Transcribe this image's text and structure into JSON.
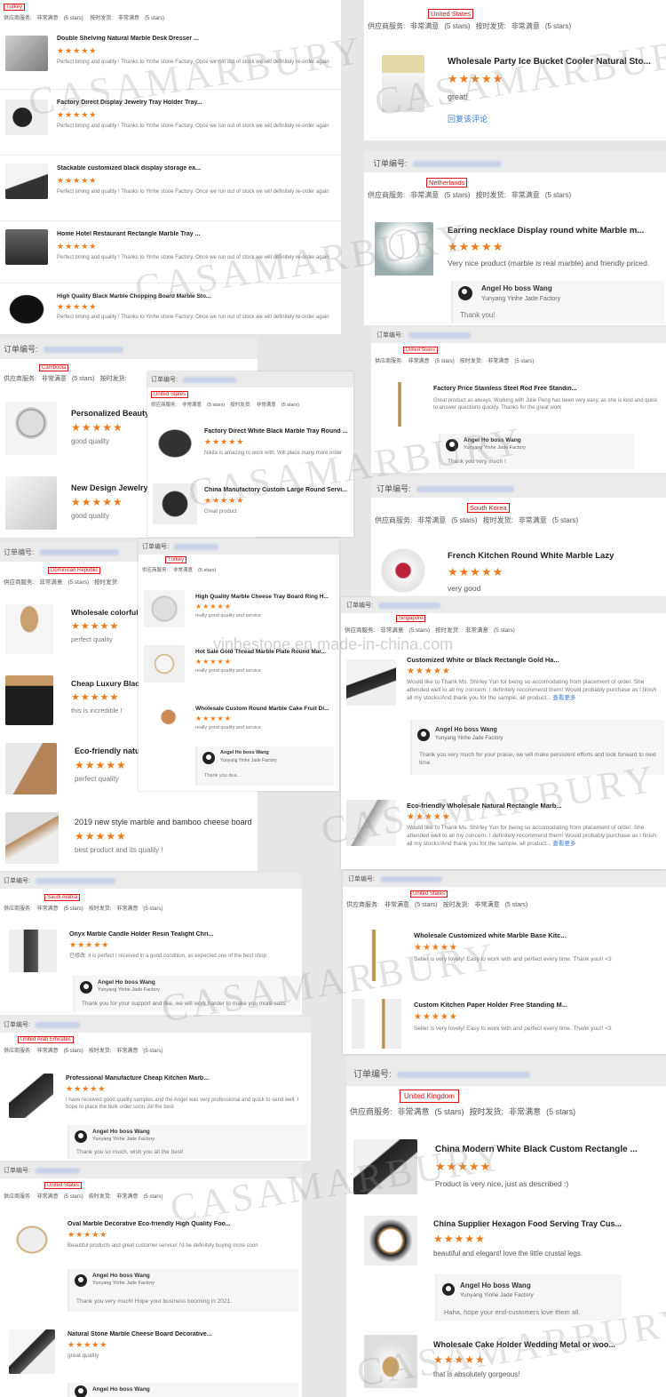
{
  "labels": {
    "order_no": "订单编号:",
    "supplier_service": "供应商服务:",
    "very_satisfied": "非常满意",
    "five_stars": "(5 stars)",
    "on_time": "按时发货:",
    "stars": "★★★★★",
    "reply_author": "Angel Ho boss Wang",
    "reply_factory": "Yunyang Yinhe Jade Factory"
  },
  "watermarks": [
    "CASAMARBURY",
    "yinhestone.en.made-in-china.com"
  ],
  "panels": {
    "a": {
      "country": "Turkey",
      "items": [
        {
          "title": "Double Shelving Natural Marble Desk Dresser ...",
          "review": "Perfect timing and quality ! Thanks to Yinhe stone Factory. Once we run out of stock we will definitely re-order again"
        },
        {
          "title": "Factory Direct Display Jewelry Tray Holder Tray...",
          "review": "Perfect timing and quality ! Thanks to Yinhe stone Factory. Once we run out of stock we will definitely re-order again"
        },
        {
          "title": "Stackable customized black display storage ea...",
          "review": "Perfect timing and quality ! Thanks to Yinhe stone Factory. Once we run out of stock we will definitely re-order again"
        },
        {
          "title": "Home Hotel Restaurant Rectangle Marble Tray ...",
          "review": "Perfect timing and quality ! Thanks to Yinhe stone Factory. Once we run out of stock we will definitely re-order again"
        },
        {
          "title": "High Quality Black Marble Chopping Board Marble Sto...",
          "review": "Perfect timing and quality ! Thanks to Yinhe stone Factory. Once we run out of stock we will definitely re-order again"
        }
      ]
    },
    "b": {
      "country": "Cambodia",
      "items": [
        {
          "title": "Personalized Beauty",
          "review": "good quality"
        },
        {
          "title": "New Design Jewelry",
          "review": "good quality"
        }
      ]
    },
    "c": {
      "country": "Dominican Republic",
      "items": [
        {
          "title": "Wholesale colorful m",
          "review": "perfect quality"
        },
        {
          "title": "Cheap Luxury Black",
          "review": "this is incredible !"
        },
        {
          "title": "Eco-friendly natu",
          "review": "perfect quality"
        },
        {
          "title": "2019 new style marble and bamboo cheese board",
          "review": "best product and its quality !"
        }
      ]
    },
    "d": {
      "country": "United States",
      "items": [
        {
          "title": "Factory Direct White Black Marble Tray Round ...",
          "review": "Nikita is amazing to work with. Will place many more order"
        },
        {
          "title": "China Manufactory Custom Large Round Servi...",
          "review": "Great product"
        }
      ]
    },
    "e": {
      "country": "Turkey",
      "items": [
        {
          "title": "High Quality Marble Cheese Tray Board Ring H...",
          "review": "really good quality and service"
        },
        {
          "title": "Hot Sale Gold Thread Marble Plate Round Mar...",
          "review": "really good quality and service"
        },
        {
          "title": "Wholesale Custom Round Marble Cake Fruit Di...",
          "review": "really good quality and service"
        }
      ],
      "reply": "Thank you dea..."
    },
    "f": {
      "country": "Saudi Arabia",
      "item": {
        "title": "Onyx Marble Candle Holder Resin Tealight Chri...",
        "review": "已修改: it is perfect I received in a good condition, as expected one of the best shop"
      },
      "reply": "Thank you for your support and like, we will work harder to make you more satis"
    },
    "g": {
      "country": "United Arab Emirates",
      "item": {
        "title": "Professional Manufacture Cheap Kitchen Marb...",
        "review": "I have received good quality samples and the Angel was very professional and quick to send well. I hope to place the bulk order soon. All the best"
      },
      "reply": "Thank you so much, wish you all the best!"
    },
    "h": {
      "country": "United States",
      "items": [
        {
          "title": "Oval Marble Decorative Eco-friendly High Quality Foo...",
          "review": "Beautiful products and great customer service! I'd be definitely buying more soon"
        },
        {
          "title": "Natural Stone Marble Cheese Board Decorative...",
          "review": "great quality"
        }
      ],
      "reply": "Thank you very much! Hope your business booming in 2021."
    },
    "i": {
      "country": "United States",
      "item": {
        "title": "Wholesale Party Ice Bucket Cooler Natural Sto...",
        "review": "great!",
        "link": "回复该评论"
      }
    },
    "j": {
      "country": "Netherlands",
      "item": {
        "title": "Earring necklace Display round white Marble m...",
        "review": "Very nice product (marble is real marble) and friendly priced."
      },
      "reply": "Thank you!"
    },
    "k": {
      "country": "United States",
      "item": {
        "title": "Factory Price Stainless Steel Rod Free Standin...",
        "review": "Great product as always. Working with Julie Peng has been very easy, as she is kind and quick to answer questions quickly. Thanks for the great work"
      },
      "reply": "Thank you very much !"
    },
    "l": {
      "country": "South Korea",
      "item": {
        "title": "French Kitchen Round White Marble Lazy",
        "review": "very good"
      }
    },
    "m": {
      "country": "Singapore",
      "items": [
        {
          "title": "Customized White or Black Rectangle Gold Ha...",
          "review": "Would like to Thank Ms. Shirley Yun for being so accomodating from placement of order. She attended well to all my concern. I definitely recommend them! Would probably purchase as I finish all my stocks!And thank you for the sample, all product...",
          "more": "查看更多"
        },
        {
          "title": "Eco-friendly Wholesale Natural Rectangle Marb...",
          "review": "Would like to Thank Ms. Shirley Yun for being so accomodating from placement of order. She attended well to all my concern. I definitely recommend them! Would probably purchase as I finish all my stocks!And thank you for the sample, all product...",
          "more": "查看更多"
        }
      ],
      "reply": "Thank you very much for your praise, we will make persistent efforts and look forward to next time"
    },
    "n": {
      "country": "United States",
      "items": [
        {
          "title": "Wholesale Customized white Marble Base Kitc...",
          "review": "Seller is very lovely! Easy to work with and perfect every time. Thank you!! <3"
        },
        {
          "title": "Custom Kitchen Paper Holder Free Standing M...",
          "review": "Seller is very lovely! Easy to work with and perfect every time. Thank you!! <3"
        }
      ]
    },
    "o": {
      "country": "United Kingdom",
      "items": [
        {
          "title": "China Modern White Black Custom Rectangle ...",
          "review": "Product is very nice, just as described :)"
        },
        {
          "title": "China Supplier Hexagon Food Serving Tray Cus...",
          "review": "beautiful and elegant! love the little crustal legs."
        },
        {
          "title": "Wholesale Cake Holder Wedding Metal or woo...",
          "review": "that is absolutely gorgeous!"
        }
      ],
      "reply": "Haha, hope your end-customers love them all."
    }
  }
}
